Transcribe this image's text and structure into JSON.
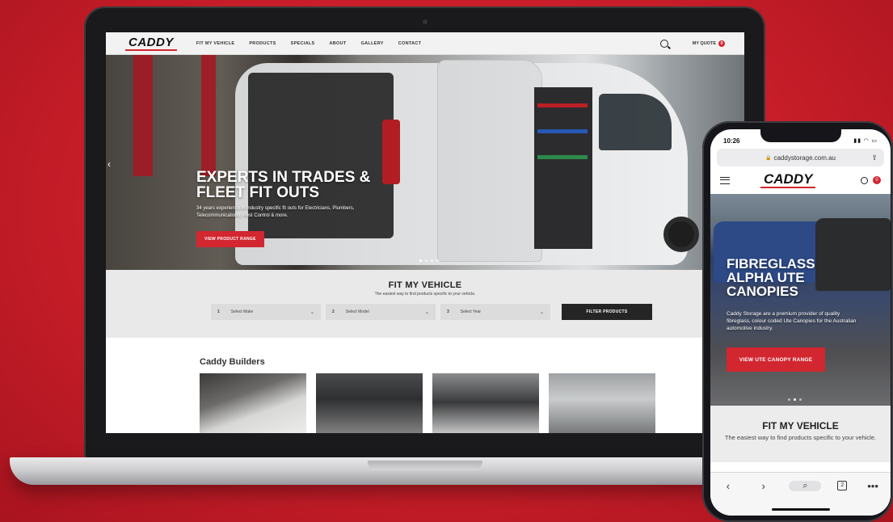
{
  "laptop": {
    "header": {
      "logo": "CADDY",
      "nav": [
        "FIT MY VEHICLE",
        "PRODUCTS",
        "SPECIALS",
        "ABOUT",
        "GALLERY",
        "CONTACT"
      ],
      "quote_label": "MY QUOTE",
      "quote_count": "0"
    },
    "hero": {
      "title": "EXPERTS IN TRADES & FLEET FIT OUTS",
      "description": "34 years experience in industry specific fit outs for Electricians, Plumbers, Telecommunications, Pest Control & more.",
      "button": "VIEW PRODUCT RANGE",
      "prev_arrow": "‹"
    },
    "fit": {
      "title": "FIT MY VEHICLE",
      "subtitle": "The easiest way to find products specific to your vehicle.",
      "selects": [
        {
          "num": "1",
          "placeholder": "Select Make",
          "chevron": "⌄"
        },
        {
          "num": "2",
          "placeholder": "Select Model",
          "chevron": "⌄"
        },
        {
          "num": "3",
          "placeholder": "Select Year",
          "chevron": "⌄"
        }
      ],
      "filter_button": "FILTER PRODUCTS"
    },
    "builders": {
      "title": "Caddy Builders"
    }
  },
  "phone": {
    "time": "10:26",
    "status_icons": "▮▮ ◠ ▭",
    "url": "caddystorage.com.au",
    "lock": "🔒",
    "share": "⇪",
    "logo": "CADDY",
    "quote_count": "0",
    "hero": {
      "title": "FIBREGLASS ALPHA UTE CANOPIES",
      "description": "Caddy Storage are a premium provider of quality fibreglass, colour coded Ute Canopies for the Australian automotive industry.",
      "button": "VIEW UTE CANOPY RANGE"
    },
    "fit": {
      "title": "FIT MY VEHICLE",
      "subtitle": "The easiest way to find products specific to your vehicle."
    },
    "browser": {
      "back": "‹",
      "forward": "›",
      "search": "⌕",
      "tabs": "2",
      "more": "•••"
    }
  },
  "colors": {
    "brand_red": "#d22630",
    "background_red": "#c81e29",
    "dark_button": "#252525"
  }
}
